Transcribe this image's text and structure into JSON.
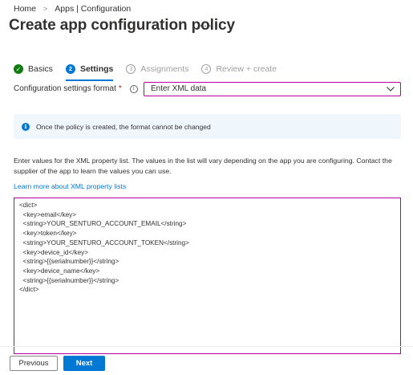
{
  "breadcrumb": {
    "home": "Home",
    "separator": ">",
    "current": "Apps | Configuration"
  },
  "page": {
    "title": "Create app configuration policy",
    "more": "···"
  },
  "steps": [
    {
      "number": "✓",
      "label": "Basics",
      "state": "done"
    },
    {
      "number": "2",
      "label": "Settings",
      "state": "active"
    },
    {
      "number": "3",
      "label": "Assignments",
      "state": "todo"
    },
    {
      "number": "4",
      "label": "Review + create",
      "state": "todo"
    }
  ],
  "format": {
    "label": "Configuration settings format",
    "required_mark": "*",
    "info_icon": "i",
    "selected": "Enter XML data"
  },
  "banner": {
    "icon": "i",
    "text": "Once the policy is created, the format cannot be changed"
  },
  "description": "Enter values for the XML property list. The values in the list will vary depending on the app you are configuring. Contact the supplier of the app to learn the values you can use.",
  "learn_link": "Learn more about XML property lists",
  "xml": "<dict>\n  <key>email</key>\n  <string>YOUR_SENTURO_ACCOUNT_EMAIL</string>\n  <key>token</key>\n  <string>YOUR_SENTURO_ACCOUNT_TOKEN</string>\n  <key>device_id</key>\n  <string>{{serialnumber}}</string>\n  <key>device_name</key>\n  <string>{{serialnumber}}</string>\n</dict>",
  "footer": {
    "previous": "Previous",
    "next": "Next"
  },
  "colors": {
    "accent": "#0078d4",
    "success": "#107c10",
    "focus_border": "#b4009e",
    "banner_bg": "#eff6fc"
  }
}
